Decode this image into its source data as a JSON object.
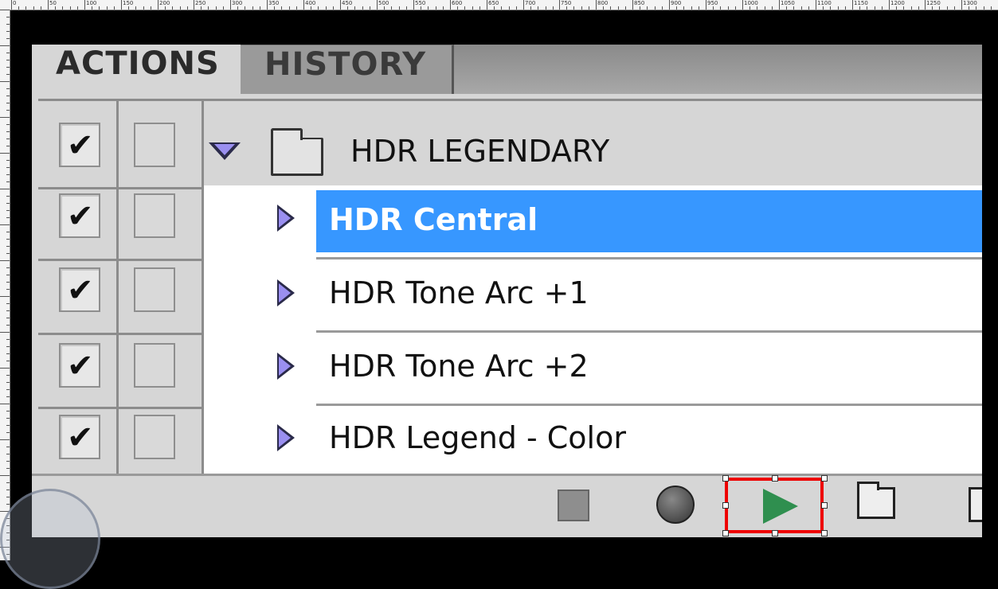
{
  "ruler": {
    "labels": [
      "0",
      "50",
      "100",
      "150",
      "200",
      "250",
      "300",
      "350",
      "400",
      "450",
      "500",
      "550",
      "600",
      "650",
      "700",
      "750",
      "800",
      "850",
      "900",
      "950",
      "1000",
      "1050",
      "1100",
      "1150",
      "1200",
      "1250",
      "1300"
    ]
  },
  "tabs": [
    {
      "label": "ACTIONS",
      "active": true
    },
    {
      "label": "HISTORY",
      "active": false
    }
  ],
  "action_set": {
    "name": "HDR LEGENDARY",
    "expanded": true,
    "enabled": true
  },
  "actions": [
    {
      "name": "HDR Central",
      "selected": true,
      "enabled": true
    },
    {
      "name": "HDR Tone Arc +1",
      "selected": false,
      "enabled": true
    },
    {
      "name": "HDR Tone Arc +2",
      "selected": false,
      "enabled": true
    },
    {
      "name": "HDR Legend - Color",
      "selected": false,
      "enabled": true
    }
  ],
  "toolbar": {
    "buttons": [
      "stop-icon",
      "record-icon",
      "play-icon",
      "new-set-icon",
      "new-action-icon"
    ],
    "highlight_color": "#e00000"
  },
  "colors": {
    "selection": "#3797ff",
    "panel": "#d6d6d6"
  }
}
